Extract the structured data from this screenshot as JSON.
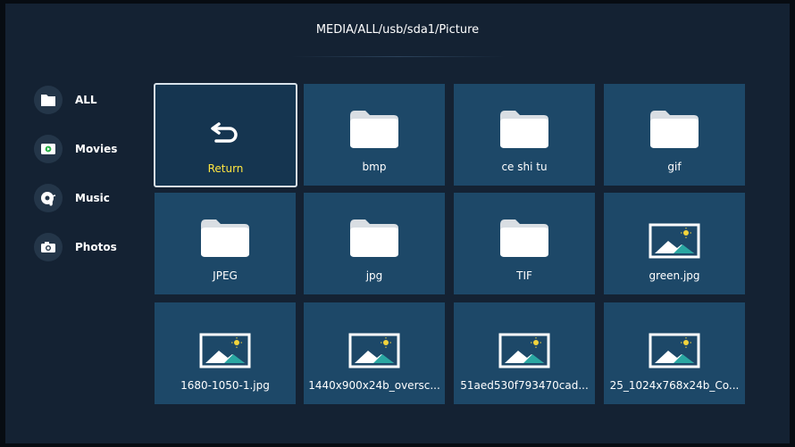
{
  "header": {
    "path": "MEDIA/ALL/usb/sda1/Picture"
  },
  "sidebar": {
    "items": [
      {
        "label": "ALL",
        "icon": "folder-icon"
      },
      {
        "label": "Movies",
        "icon": "movie-icon"
      },
      {
        "label": "Music",
        "icon": "music-icon"
      },
      {
        "label": "Photos",
        "icon": "camera-icon"
      }
    ]
  },
  "grid": {
    "items": [
      {
        "label": "Return",
        "icon": "return-icon",
        "focused": true
      },
      {
        "label": "bmp",
        "icon": "folder-icon"
      },
      {
        "label": "ce shi tu",
        "icon": "folder-icon"
      },
      {
        "label": "gif",
        "icon": "folder-icon"
      },
      {
        "label": "JPEG",
        "icon": "folder-icon"
      },
      {
        "label": "jpg",
        "icon": "folder-icon"
      },
      {
        "label": "TIF",
        "icon": "folder-icon"
      },
      {
        "label": "green.jpg",
        "icon": "image-icon"
      },
      {
        "label": "1680-1050-1.jpg",
        "icon": "image-icon"
      },
      {
        "label": "1440x900x24b_oversc...",
        "icon": "image-icon"
      },
      {
        "label": "51aed530f793470cad...",
        "icon": "image-icon"
      },
      {
        "label": "25_1024x768x24b_Co...",
        "icon": "image-icon"
      }
    ]
  },
  "colors": {
    "background": "#142233",
    "tile": "#1d4868",
    "focus_text": "#ffe640",
    "focus_border": "#d8e2ea"
  }
}
